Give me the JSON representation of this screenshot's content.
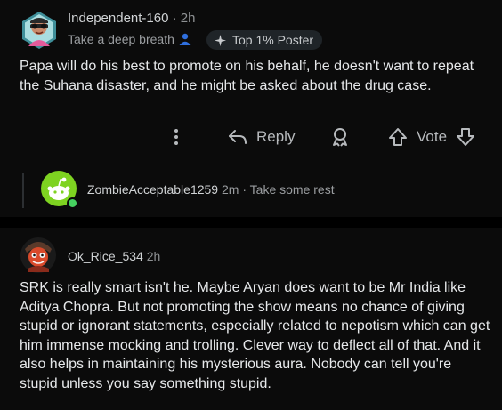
{
  "comments": [
    {
      "username": "Independent-160",
      "separator": "·",
      "age": "2h",
      "flair": "Take a deep breath",
      "flair_icon": "person-icon",
      "badge": "Top 1% Poster",
      "badge_icon": "sparkle-icon",
      "body": "Papa will do his best to promote on his behalf, he doesn't want to repeat the Suhana disaster, and he might be asked about the drug case.",
      "actions": {
        "more_icon": "more-vertical-icon",
        "reply_label": "Reply",
        "award_icon": "award-icon",
        "vote_label": "Vote"
      },
      "collapsed_reply": {
        "username": "ZombieAcceptable1259",
        "age": "2m",
        "separator": "·",
        "flair": "Take some rest",
        "online": true
      }
    },
    {
      "username": "Ok_Rice_534",
      "age": "2h",
      "body": "SRK is really smart isn't he. Maybe Aryan does want to be Mr India like Aditya Chopra. But not promoting the show means no chance of giving stupid or ignorant statements, especially related to nepotism which can get him immense mocking and trolling. Clever way to deflect all of that. And it also helps in maintaining his mysterious aura. Nobody can tell you're stupid unless you say something stupid."
    }
  ],
  "colors": {
    "background": "#000000",
    "card": "#0b0b0b",
    "text": "#e6e8ea",
    "meta": "#9a9da0",
    "online": "#46d160",
    "flair_icon": "#2f6fde"
  }
}
